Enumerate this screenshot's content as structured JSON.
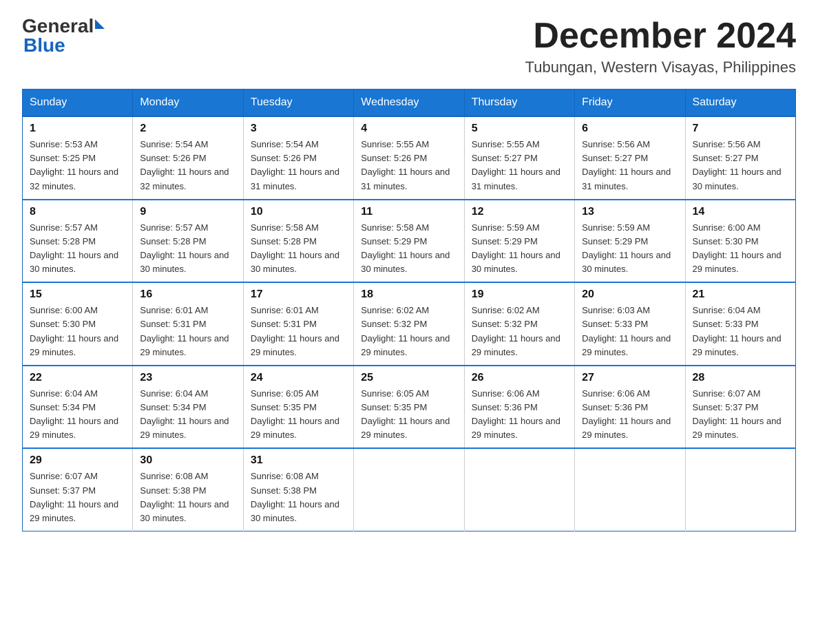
{
  "logo": {
    "text_general": "General",
    "text_blue": "Blue",
    "triangle_color": "#1565c0"
  },
  "header": {
    "month_title": "December 2024",
    "location": "Tubungan, Western Visayas, Philippines"
  },
  "days_of_week": [
    "Sunday",
    "Monday",
    "Tuesday",
    "Wednesday",
    "Thursday",
    "Friday",
    "Saturday"
  ],
  "weeks": [
    [
      {
        "day": "1",
        "sunrise": "5:53 AM",
        "sunset": "5:25 PM",
        "daylight": "11 hours and 32 minutes."
      },
      {
        "day": "2",
        "sunrise": "5:54 AM",
        "sunset": "5:26 PM",
        "daylight": "11 hours and 32 minutes."
      },
      {
        "day": "3",
        "sunrise": "5:54 AM",
        "sunset": "5:26 PM",
        "daylight": "11 hours and 31 minutes."
      },
      {
        "day": "4",
        "sunrise": "5:55 AM",
        "sunset": "5:26 PM",
        "daylight": "11 hours and 31 minutes."
      },
      {
        "day": "5",
        "sunrise": "5:55 AM",
        "sunset": "5:27 PM",
        "daylight": "11 hours and 31 minutes."
      },
      {
        "day": "6",
        "sunrise": "5:56 AM",
        "sunset": "5:27 PM",
        "daylight": "11 hours and 31 minutes."
      },
      {
        "day": "7",
        "sunrise": "5:56 AM",
        "sunset": "5:27 PM",
        "daylight": "11 hours and 30 minutes."
      }
    ],
    [
      {
        "day": "8",
        "sunrise": "5:57 AM",
        "sunset": "5:28 PM",
        "daylight": "11 hours and 30 minutes."
      },
      {
        "day": "9",
        "sunrise": "5:57 AM",
        "sunset": "5:28 PM",
        "daylight": "11 hours and 30 minutes."
      },
      {
        "day": "10",
        "sunrise": "5:58 AM",
        "sunset": "5:28 PM",
        "daylight": "11 hours and 30 minutes."
      },
      {
        "day": "11",
        "sunrise": "5:58 AM",
        "sunset": "5:29 PM",
        "daylight": "11 hours and 30 minutes."
      },
      {
        "day": "12",
        "sunrise": "5:59 AM",
        "sunset": "5:29 PM",
        "daylight": "11 hours and 30 minutes."
      },
      {
        "day": "13",
        "sunrise": "5:59 AM",
        "sunset": "5:29 PM",
        "daylight": "11 hours and 30 minutes."
      },
      {
        "day": "14",
        "sunrise": "6:00 AM",
        "sunset": "5:30 PM",
        "daylight": "11 hours and 29 minutes."
      }
    ],
    [
      {
        "day": "15",
        "sunrise": "6:00 AM",
        "sunset": "5:30 PM",
        "daylight": "11 hours and 29 minutes."
      },
      {
        "day": "16",
        "sunrise": "6:01 AM",
        "sunset": "5:31 PM",
        "daylight": "11 hours and 29 minutes."
      },
      {
        "day": "17",
        "sunrise": "6:01 AM",
        "sunset": "5:31 PM",
        "daylight": "11 hours and 29 minutes."
      },
      {
        "day": "18",
        "sunrise": "6:02 AM",
        "sunset": "5:32 PM",
        "daylight": "11 hours and 29 minutes."
      },
      {
        "day": "19",
        "sunrise": "6:02 AM",
        "sunset": "5:32 PM",
        "daylight": "11 hours and 29 minutes."
      },
      {
        "day": "20",
        "sunrise": "6:03 AM",
        "sunset": "5:33 PM",
        "daylight": "11 hours and 29 minutes."
      },
      {
        "day": "21",
        "sunrise": "6:04 AM",
        "sunset": "5:33 PM",
        "daylight": "11 hours and 29 minutes."
      }
    ],
    [
      {
        "day": "22",
        "sunrise": "6:04 AM",
        "sunset": "5:34 PM",
        "daylight": "11 hours and 29 minutes."
      },
      {
        "day": "23",
        "sunrise": "6:04 AM",
        "sunset": "5:34 PM",
        "daylight": "11 hours and 29 minutes."
      },
      {
        "day": "24",
        "sunrise": "6:05 AM",
        "sunset": "5:35 PM",
        "daylight": "11 hours and 29 minutes."
      },
      {
        "day": "25",
        "sunrise": "6:05 AM",
        "sunset": "5:35 PM",
        "daylight": "11 hours and 29 minutes."
      },
      {
        "day": "26",
        "sunrise": "6:06 AM",
        "sunset": "5:36 PM",
        "daylight": "11 hours and 29 minutes."
      },
      {
        "day": "27",
        "sunrise": "6:06 AM",
        "sunset": "5:36 PM",
        "daylight": "11 hours and 29 minutes."
      },
      {
        "day": "28",
        "sunrise": "6:07 AM",
        "sunset": "5:37 PM",
        "daylight": "11 hours and 29 minutes."
      }
    ],
    [
      {
        "day": "29",
        "sunrise": "6:07 AM",
        "sunset": "5:37 PM",
        "daylight": "11 hours and 29 minutes."
      },
      {
        "day": "30",
        "sunrise": "6:08 AM",
        "sunset": "5:38 PM",
        "daylight": "11 hours and 30 minutes."
      },
      {
        "day": "31",
        "sunrise": "6:08 AM",
        "sunset": "5:38 PM",
        "daylight": "11 hours and 30 minutes."
      },
      null,
      null,
      null,
      null
    ]
  ],
  "labels": {
    "sunrise_prefix": "Sunrise: ",
    "sunset_prefix": "Sunset: ",
    "daylight_prefix": "Daylight: "
  }
}
